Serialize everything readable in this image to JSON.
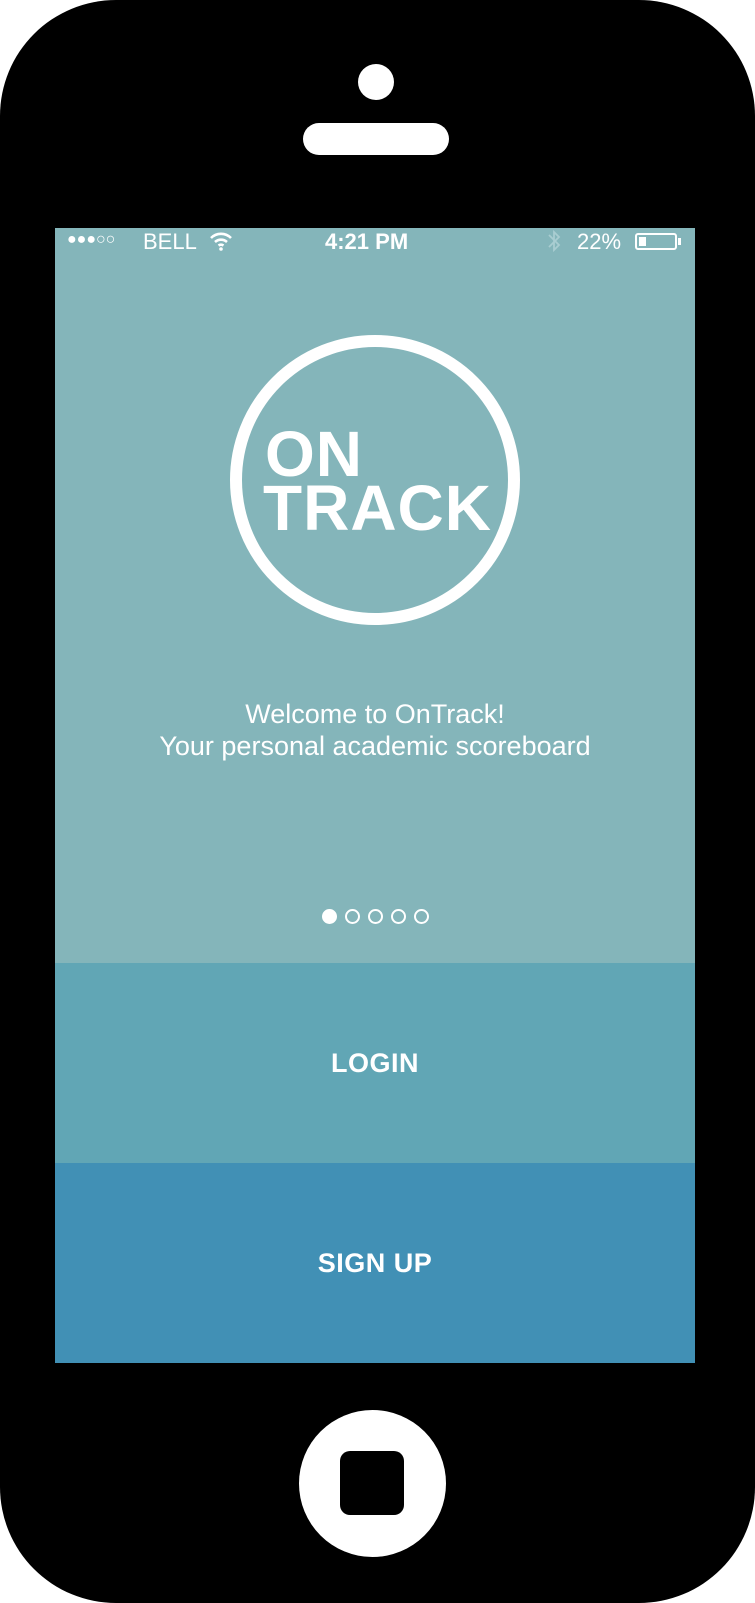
{
  "status_bar": {
    "signal": "●●●○○",
    "carrier": "BELL",
    "wifi_icon": "wifi-icon",
    "time": "4:21 PM",
    "bluetooth_icon": "bluetooth-icon",
    "battery_percent": "22%",
    "battery_level": 0.22
  },
  "logo": {
    "line1": "ON",
    "line2": "TRACK"
  },
  "welcome": {
    "line1": "Welcome to OnTrack!",
    "line2": "Your personal academic scoreboard"
  },
  "pager": {
    "count": 5,
    "active_index": 0
  },
  "buttons": {
    "login_label": "LOGIN",
    "signup_label": "SIGN UP"
  },
  "colors": {
    "screen_bg": "#84b5ba",
    "login_bg": "#61a6b5",
    "signup_bg": "#4190b5"
  }
}
